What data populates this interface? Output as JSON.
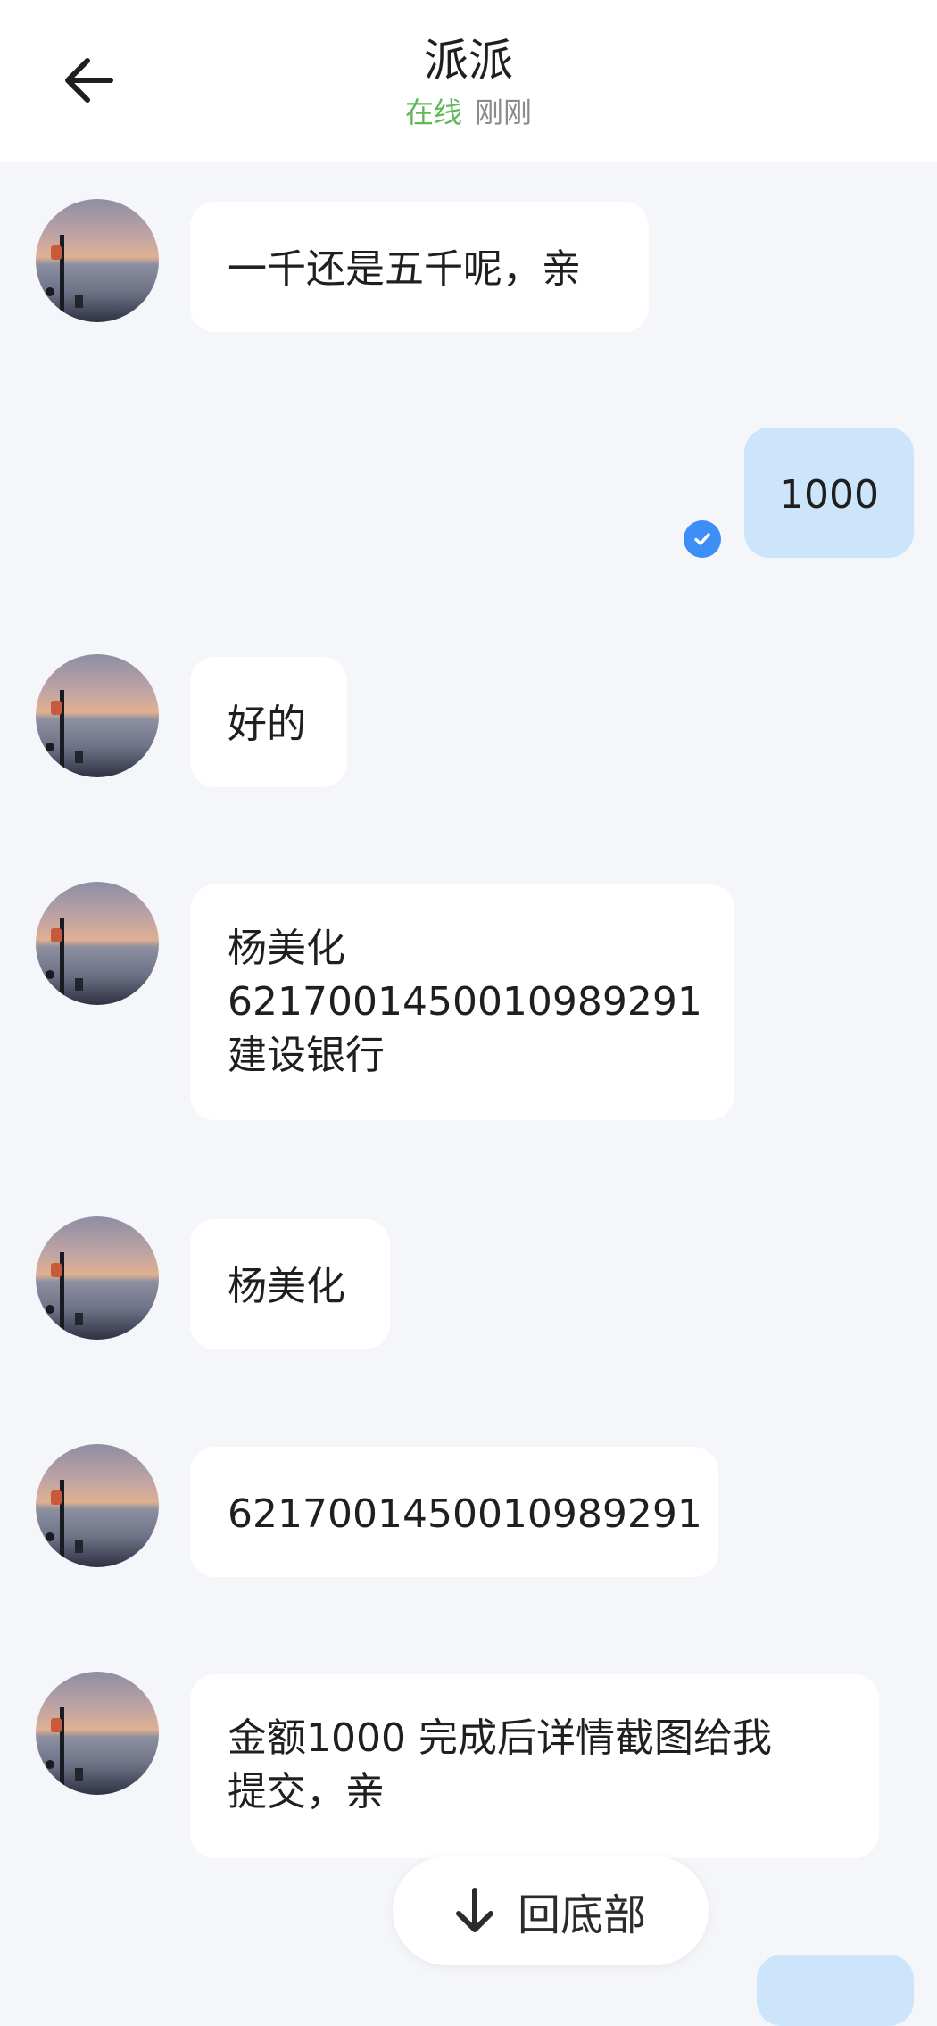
{
  "header": {
    "contact_name": "派派",
    "online_status": "在线",
    "last_seen": "刚刚",
    "back_icon": "arrow-left-icon"
  },
  "messages": [
    {
      "side": "left",
      "lines": [
        "一千还是五千呢，亲"
      ]
    },
    {
      "side": "right",
      "lines": [
        "1000"
      ],
      "read": true
    },
    {
      "side": "left",
      "lines": [
        "好的"
      ]
    },
    {
      "side": "left",
      "lines": [
        "杨美化",
        "6217001450010989291",
        "建设银行"
      ]
    },
    {
      "side": "left",
      "lines": [
        "杨美化"
      ]
    },
    {
      "side": "left",
      "lines": [
        "6217001450010989291"
      ]
    },
    {
      "side": "left",
      "lines": [
        "金额1000  完成后详情截图给我",
        "提交，亲"
      ]
    }
  ],
  "scroll_button": {
    "label": "回底部",
    "icon": "arrow-down-icon"
  },
  "colors": {
    "background": "#f5f6fa",
    "incoming_bubble": "#ffffff",
    "outgoing_bubble": "#cde5fb",
    "online_green": "#5fb85a",
    "read_check_blue": "#3e8ef7"
  }
}
